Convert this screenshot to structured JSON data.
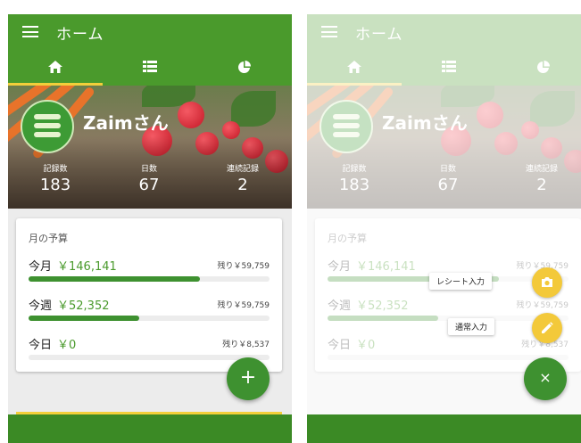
{
  "appbar": {
    "title": "ホーム"
  },
  "profile": {
    "username": "Zaimさん"
  },
  "stats": [
    {
      "label": "記録数",
      "value": "183"
    },
    {
      "label": "日数",
      "value": "67"
    },
    {
      "label": "連続記録",
      "value": "2"
    }
  ],
  "budget": {
    "title": "月の予算",
    "rows": [
      {
        "name": "今月",
        "amount": "￥146,141",
        "remaining": "残り￥59,759",
        "progress": 0.71
      },
      {
        "name": "今週",
        "amount": "￥52,352",
        "remaining": "残り￥59,759",
        "progress": 0.46
      },
      {
        "name": "今日",
        "amount": "￥0",
        "remaining": "残り￥8,537",
        "progress": 0.0
      }
    ]
  },
  "fab": {
    "add_symbol": "+",
    "close_symbol": "×"
  },
  "speed_dial": {
    "receipt_label": "レシート入力",
    "manual_label": "通常入力"
  },
  "tabs": [
    "home-icon",
    "list-icon",
    "pie-chart-icon"
  ],
  "colors": {
    "primary": "#4a9a2c",
    "accent": "#f2cf3a",
    "dark": "#3b8a25"
  }
}
